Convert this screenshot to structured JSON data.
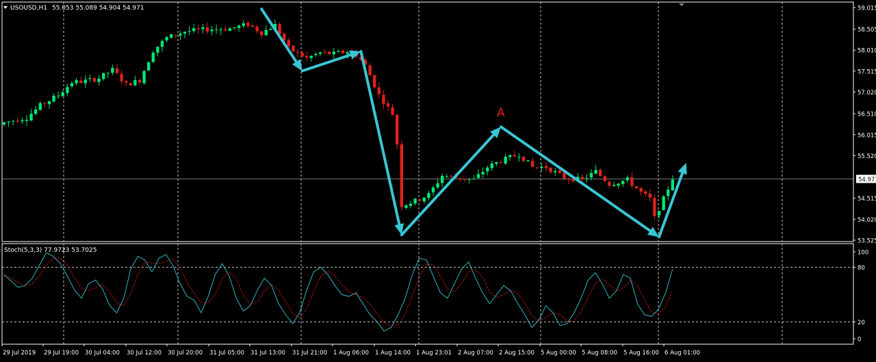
{
  "header": {
    "symbol_timeframe": "USOUSD,H1",
    "ohlc": "55.053 55.089 54.904 54.971",
    "dropdown_icon": "triangle-down-icon"
  },
  "indicator": {
    "label": "Stoch(5,3,3) 77.9723 53.7025"
  },
  "annotation": {
    "label_a": "A"
  },
  "colors": {
    "background": "#000000",
    "bull": "#00e676",
    "bear": "#e0201b",
    "arrow": "#39c6d3",
    "grid": "#c8c8c8",
    "stoch_main": "#30b7c2",
    "stoch_signal": "#e0201b",
    "text": "#ffffff",
    "annotation": "#e0201b"
  },
  "chart_data": [
    {
      "type": "candlestick",
      "symbol": "USOUSD",
      "timeframe": "H1",
      "ylim": [
        53.525,
        59.015
      ],
      "y_ticks": [
        "59.015",
        "58.505",
        "58.010",
        "57.515",
        "57.020",
        "56.510",
        "56.015",
        "55.520",
        "54.971",
        "54.515",
        "54.020",
        "53.525"
      ],
      "current_price": "54.971",
      "x_ticks": [
        "29 Jul 2019",
        "29 Jul 19:00",
        "30 Jul 04:00",
        "30 Jul 12:00",
        "30 Jul 20:00",
        "31 Jul 05:00",
        "31 Jul 13:00",
        "31 Jul 21:00",
        "1 Aug 06:00",
        "1 Aug 14:00",
        "1 Aug 23:01",
        "2 Aug 07:00",
        "2 Aug 15:00",
        "5 Aug 00:00",
        "5 Aug 08:00",
        "5 Aug 16:00",
        "6 Aug 01:00"
      ],
      "close_path": [
        [
          0,
          56.3
        ],
        [
          5,
          56.42
        ],
        [
          8,
          56.7
        ],
        [
          12,
          56.95
        ],
        [
          15,
          57.25
        ],
        [
          18,
          57.28
        ],
        [
          21,
          57.35
        ],
        [
          24,
          57.55
        ],
        [
          27,
          57.2
        ],
        [
          30,
          57.3
        ],
        [
          33,
          58.0
        ],
        [
          36,
          58.3
        ],
        [
          40,
          58.45
        ],
        [
          45,
          58.5
        ],
        [
          50,
          58.52
        ],
        [
          54,
          58.62
        ],
        [
          57,
          58.42
        ],
        [
          60,
          58.6
        ],
        [
          63,
          58.05
        ],
        [
          67,
          57.82
        ],
        [
          70,
          57.95
        ],
        [
          73,
          57.92
        ],
        [
          76,
          57.98
        ],
        [
          78,
          57.9
        ],
        [
          80,
          57.65
        ],
        [
          83,
          56.95
        ],
        [
          86,
          56.5
        ],
        [
          87,
          55.8
        ],
        [
          88,
          54.35
        ],
        [
          91,
          54.45
        ],
        [
          94,
          54.6
        ],
        [
          97,
          55.05
        ],
        [
          100,
          55.0
        ],
        [
          104,
          54.95
        ],
        [
          107,
          55.25
        ],
        [
          110,
          55.4
        ],
        [
          114,
          55.55
        ],
        [
          117,
          55.25
        ],
        [
          120,
          55.25
        ],
        [
          124,
          55.0
        ],
        [
          128,
          54.95
        ],
        [
          131,
          55.15
        ],
        [
          134,
          54.85
        ],
        [
          138,
          54.95
        ],
        [
          141,
          54.65
        ],
        [
          143,
          54.5
        ],
        [
          144,
          54.05
        ],
        [
          146,
          54.5
        ],
        [
          148,
          54.99
        ]
      ],
      "arrows": [
        {
          "from": [
            57,
            58.98
          ],
          "to": [
            66,
            57.52
          ]
        },
        {
          "from": [
            66,
            57.52
          ],
          "to": [
            79,
            57.98
          ]
        },
        {
          "from": [
            79,
            57.98
          ],
          "to": [
            88,
            53.65
          ]
        },
        {
          "from": [
            88,
            53.65
          ],
          "to": [
            110,
            56.2
          ]
        },
        {
          "from": [
            110,
            56.2
          ],
          "to": [
            145,
            53.6
          ]
        },
        {
          "from": [
            145,
            53.6
          ],
          "to": [
            151,
            55.35
          ]
        }
      ],
      "annotation_point": {
        "label": "A",
        "x": 110,
        "y": 56.45
      }
    },
    {
      "type": "line",
      "name": "Stoch(5,3,3)",
      "ylim": [
        0,
        100
      ],
      "y_ticks": [
        "100",
        "80",
        "20",
        "0"
      ],
      "levels": [
        80,
        20
      ],
      "series": [
        {
          "role": "main",
          "values": [
            72,
            65,
            58,
            60,
            68,
            82,
            96,
            92,
            84,
            70,
            55,
            46,
            62,
            66,
            56,
            38,
            30,
            46,
            78,
            92,
            88,
            75,
            90,
            94,
            82,
            62,
            48,
            44,
            30,
            48,
            72,
            84,
            70,
            46,
            32,
            38,
            55,
            68,
            60,
            40,
            28,
            18,
            30,
            55,
            75,
            80,
            72,
            60,
            50,
            48,
            52,
            40,
            28,
            20,
            10,
            14,
            28,
            46,
            72,
            90,
            88,
            70,
            52,
            46,
            62,
            78,
            86,
            68,
            52,
            40,
            50,
            60,
            54,
            40,
            28,
            14,
            22,
            38,
            30,
            16,
            18,
            30,
            46,
            66,
            74,
            62,
            46,
            54,
            72,
            68,
            40,
            28,
            26,
            34,
            52,
            78
          ]
        },
        {
          "role": "signal",
          "values": [
            70,
            68,
            63,
            60,
            62,
            70,
            82,
            90,
            90,
            82,
            68,
            57,
            54,
            58,
            61,
            53,
            41,
            38,
            51,
            72,
            86,
            85,
            84,
            86,
            89,
            79,
            64,
            51,
            41,
            41,
            50,
            68,
            75,
            67,
            49,
            39,
            42,
            54,
            61,
            55,
            43,
            29,
            25,
            34,
            53,
            70,
            76,
            71,
            61,
            53,
            50,
            47,
            40,
            29,
            19,
            15,
            17,
            29,
            49,
            69,
            83,
            83,
            70,
            56,
            53,
            62,
            75,
            77,
            69,
            53,
            47,
            50,
            55,
            51,
            41,
            27,
            21,
            25,
            30,
            28,
            21,
            21,
            31,
            47,
            62,
            67,
            61,
            54,
            57,
            65,
            60,
            45,
            31,
            29,
            37,
            54
          ]
        }
      ]
    }
  ]
}
